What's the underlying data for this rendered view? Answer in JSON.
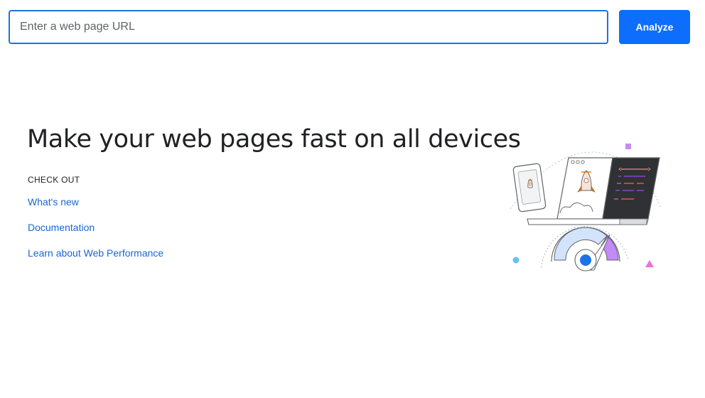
{
  "search": {
    "placeholder": "Enter a web page URL",
    "value": ""
  },
  "analyze_button": {
    "label": "Analyze",
    "color": "#0d6efd"
  },
  "hero": {
    "title": "Make your web pages fast on all devices"
  },
  "checkout": {
    "heading": "CHECK OUT",
    "links": [
      {
        "label": "What's new"
      },
      {
        "label": "Documentation"
      },
      {
        "label": "Learn about Web Performance"
      }
    ]
  },
  "colors": {
    "accent": "#1a73e8",
    "link": "#1967d2",
    "text": "#202124"
  },
  "illustration": {
    "icon": "devices-speed-gauge-illustration"
  }
}
